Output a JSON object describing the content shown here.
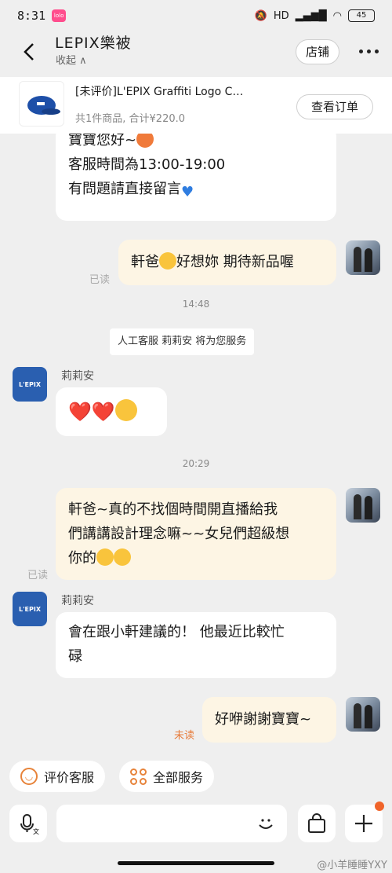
{
  "status": {
    "time": "8:31",
    "app_badge": "lolo",
    "network": "HD",
    "battery": "45"
  },
  "header": {
    "shop_name": "LEPIX樂被",
    "collapse": "收起 ∧",
    "store_button": "店铺"
  },
  "order": {
    "title": "[未评价]L'EPIX Graffiti Logo C…",
    "summary": "共1件商品, 合计¥220.0",
    "view_order_button": "查看订单"
  },
  "chat": {
    "msg1_line1": "寶寶您好~",
    "msg1_line2": "客服時間為13:00-19:00",
    "msg1_line3": "有問題請直接留言",
    "msg2_pre": "軒爸",
    "msg2_post": "好想妳 期待新品喔",
    "msg2_status": "已读",
    "time1": "14:48",
    "system_notice": "人工客服 莉莉安 将为您服务",
    "agent_name": "莉莉安",
    "avatar_text": "L'EPIX",
    "msg3_hearts": "❤️❤️",
    "time2": "20:29",
    "msg4_line1": "軒爸~真的不找個時間開直播給我",
    "msg4_line2": "們講講設計理念嘛~~女兒們超級想",
    "msg4_line3": "你的",
    "msg4_status": "已读",
    "msg5_line1": "會在跟小軒建議的！ 他最近比較忙",
    "msg5_line2": "碌",
    "msg6": "好咿謝謝寶寶~",
    "msg6_status": "未读"
  },
  "quick_actions": {
    "rate": "评价客服",
    "all_services": "全部服务"
  },
  "input": {
    "voice_sub": "文"
  },
  "watermark": "@小羊睡睡YXY",
  "colors": {
    "accent": "#e7833a",
    "bubble_self": "#fdf5e4",
    "unread": "#e77b3a"
  }
}
